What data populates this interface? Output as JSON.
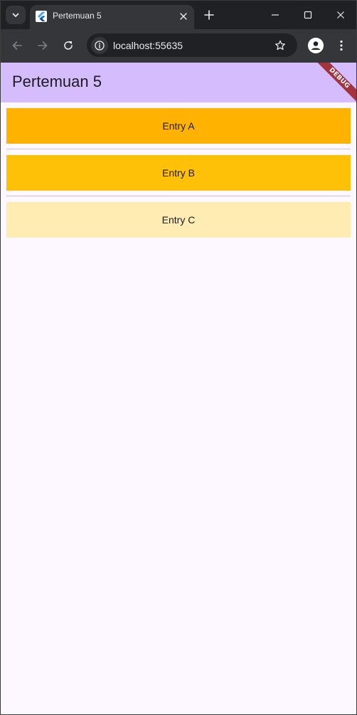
{
  "browser": {
    "tab": {
      "title": "Pertemuan 5",
      "favicon": "flutter-icon"
    },
    "toolbar": {
      "url": "localhost:55635"
    },
    "icons": {
      "tab_search": "chevron-down-icon",
      "tab_close": "close-icon",
      "new_tab": "plus-icon",
      "minimize": "minimize-icon",
      "maximize": "maximize-icon",
      "close_window": "close-icon",
      "back": "arrow-left-icon",
      "forward": "arrow-right-icon",
      "reload": "reload-icon",
      "site_info": "info-icon",
      "bookmark": "star-icon",
      "profile": "person-icon",
      "menu": "kebab-menu-icon"
    }
  },
  "app": {
    "title": "Pertemuan 5",
    "debug_banner": "DEBUG",
    "entries": [
      {
        "label": "Entry A",
        "color": "#ffb300"
      },
      {
        "label": "Entry B",
        "color": "#ffc107"
      },
      {
        "label": "Entry C",
        "color": "#ffecb3"
      }
    ],
    "colors": {
      "appbar": "#d5bdfd",
      "background": "#fdf7ff",
      "divider": "#cac4d0",
      "debug_banner": "#a1343c"
    }
  }
}
